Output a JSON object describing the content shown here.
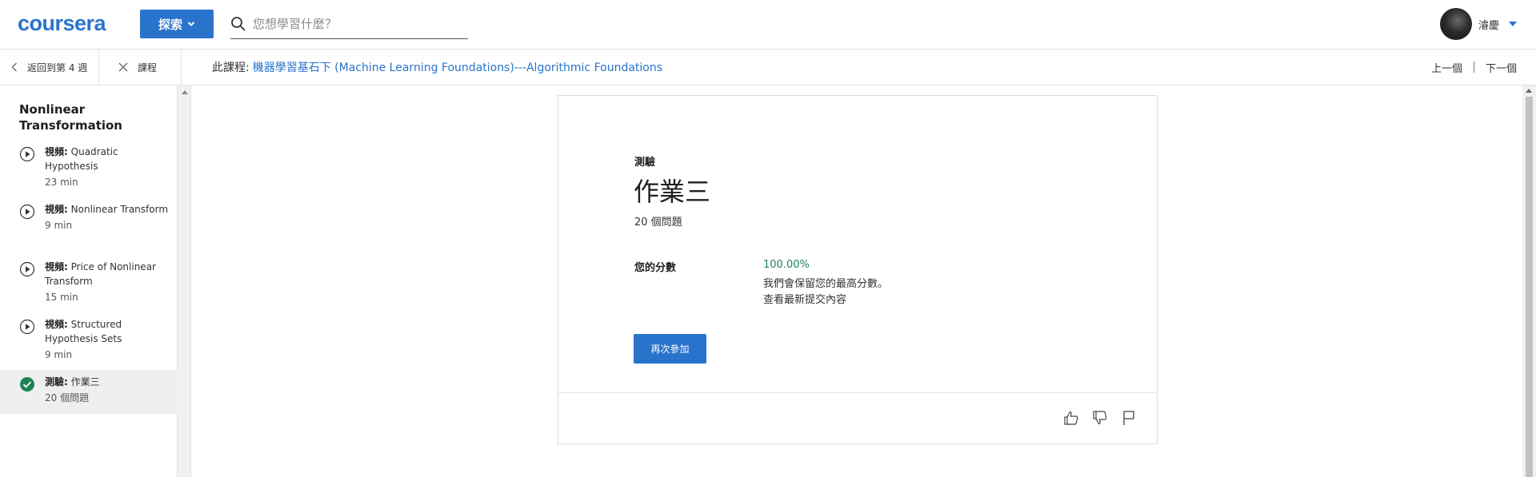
{
  "header": {
    "logo_text": "coursera",
    "explore_label": "探索",
    "search_placeholder": "您想學習什麼？",
    "user_name": "濬慶"
  },
  "subnav": {
    "back_label": "返回到第 4 週",
    "close_label": "課程",
    "course_prefix": "此課程:",
    "course_name": "機器學習基石下 (Machine Learning Foundations)---Algorithmic Foundations",
    "prev_label": "上一個",
    "next_label": "下一個"
  },
  "sidebar": {
    "module_title": "Nonlinear Transformation",
    "items": [
      {
        "kind": "視頻:",
        "title": "Quadratic Hypothesis",
        "meta": "23 min",
        "icon": "play-circle-icon",
        "active": false
      },
      {
        "kind": "視頻:",
        "title": "Nonlinear Transform",
        "meta": "9 min",
        "icon": "play-circle-icon",
        "active": false
      },
      {
        "kind": "視頻:",
        "title": "Price of Nonlinear Transform",
        "meta": "15 min",
        "icon": "play-circle-icon",
        "active": false
      },
      {
        "kind": "視頻:",
        "title": "Structured Hypothesis Sets",
        "meta": "9 min",
        "icon": "play-circle-icon",
        "active": false
      },
      {
        "kind": "測驗:",
        "title": "作業三",
        "meta": "20 個問題",
        "icon": "check-circle-icon",
        "active": true
      }
    ]
  },
  "quiz": {
    "kind_label": "測驗",
    "title": "作業三",
    "question_count": "20 個問題",
    "score_label": "您的分數",
    "score_value": "100.00%",
    "score_note": "我們會保留您的最高分數。",
    "submission_link": "查看最新提交內容",
    "retry_label": "再次參加"
  },
  "colors": {
    "brand_blue": "#2a73cc",
    "score_green": "#1f8354",
    "check_green": "#1f8354"
  }
}
